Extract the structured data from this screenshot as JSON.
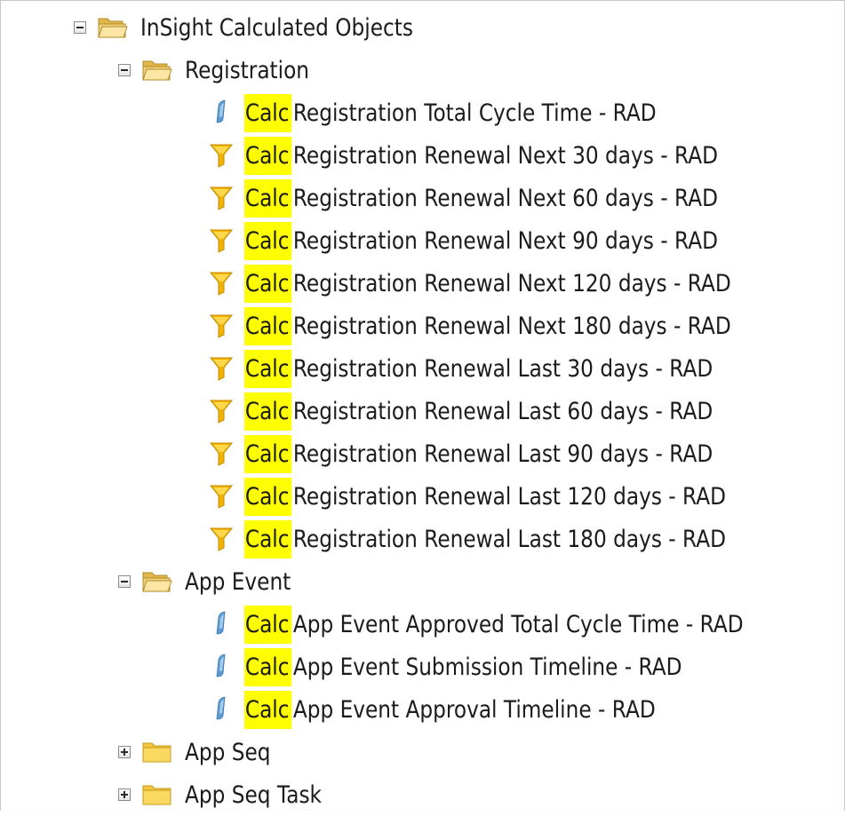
{
  "tree": {
    "root": {
      "label": "InSight Calculated Objects",
      "state": "expanded",
      "icon": "folder-open-icon"
    },
    "registration": {
      "label": "Registration",
      "state": "expanded",
      "icon": "folder-open-icon",
      "items": [
        {
          "prefix": "Calc",
          "name": "Registration Total Cycle Time - RAD",
          "icon": "measure-icon"
        },
        {
          "prefix": "Calc",
          "name": "Registration Renewal Next 30 days - RAD",
          "icon": "filter-icon"
        },
        {
          "prefix": "Calc",
          "name": "Registration Renewal Next 60 days - RAD",
          "icon": "filter-icon"
        },
        {
          "prefix": "Calc",
          "name": "Registration Renewal Next 90 days - RAD",
          "icon": "filter-icon"
        },
        {
          "prefix": "Calc",
          "name": "Registration Renewal Next 120 days - RAD",
          "icon": "filter-icon"
        },
        {
          "prefix": "Calc",
          "name": "Registration Renewal Next 180 days - RAD",
          "icon": "filter-icon"
        },
        {
          "prefix": "Calc",
          "name": "Registration Renewal Last 30 days - RAD",
          "icon": "filter-icon"
        },
        {
          "prefix": "Calc",
          "name": "Registration Renewal Last 60 days - RAD",
          "icon": "filter-icon"
        },
        {
          "prefix": "Calc",
          "name": "Registration Renewal Last 90 days - RAD",
          "icon": "filter-icon"
        },
        {
          "prefix": "Calc",
          "name": "Registration Renewal Last 120 days - RAD",
          "icon": "filter-icon"
        },
        {
          "prefix": "Calc",
          "name": "Registration Renewal Last 180 days - RAD",
          "icon": "filter-icon"
        }
      ]
    },
    "app_event": {
      "label": "App Event",
      "state": "expanded",
      "icon": "folder-open-icon",
      "items": [
        {
          "prefix": "Calc",
          "name": "App Event Approved Total Cycle Time - RAD",
          "icon": "measure-icon"
        },
        {
          "prefix": "Calc",
          "name": "App Event Submission Timeline - RAD",
          "icon": "measure-icon"
        },
        {
          "prefix": "Calc",
          "name": "App Event Approval Timeline - RAD",
          "icon": "measure-icon"
        }
      ]
    },
    "app_seq": {
      "label": "App Seq",
      "state": "collapsed",
      "icon": "folder-closed-icon"
    },
    "app_seq_task": {
      "label": "App Seq Task",
      "state": "collapsed",
      "icon": "folder-closed-icon"
    }
  },
  "colors": {
    "highlight": "#ffff00",
    "folder": "#f2c94c",
    "filter": "#f0b400",
    "measure": "#5b9bd5"
  }
}
